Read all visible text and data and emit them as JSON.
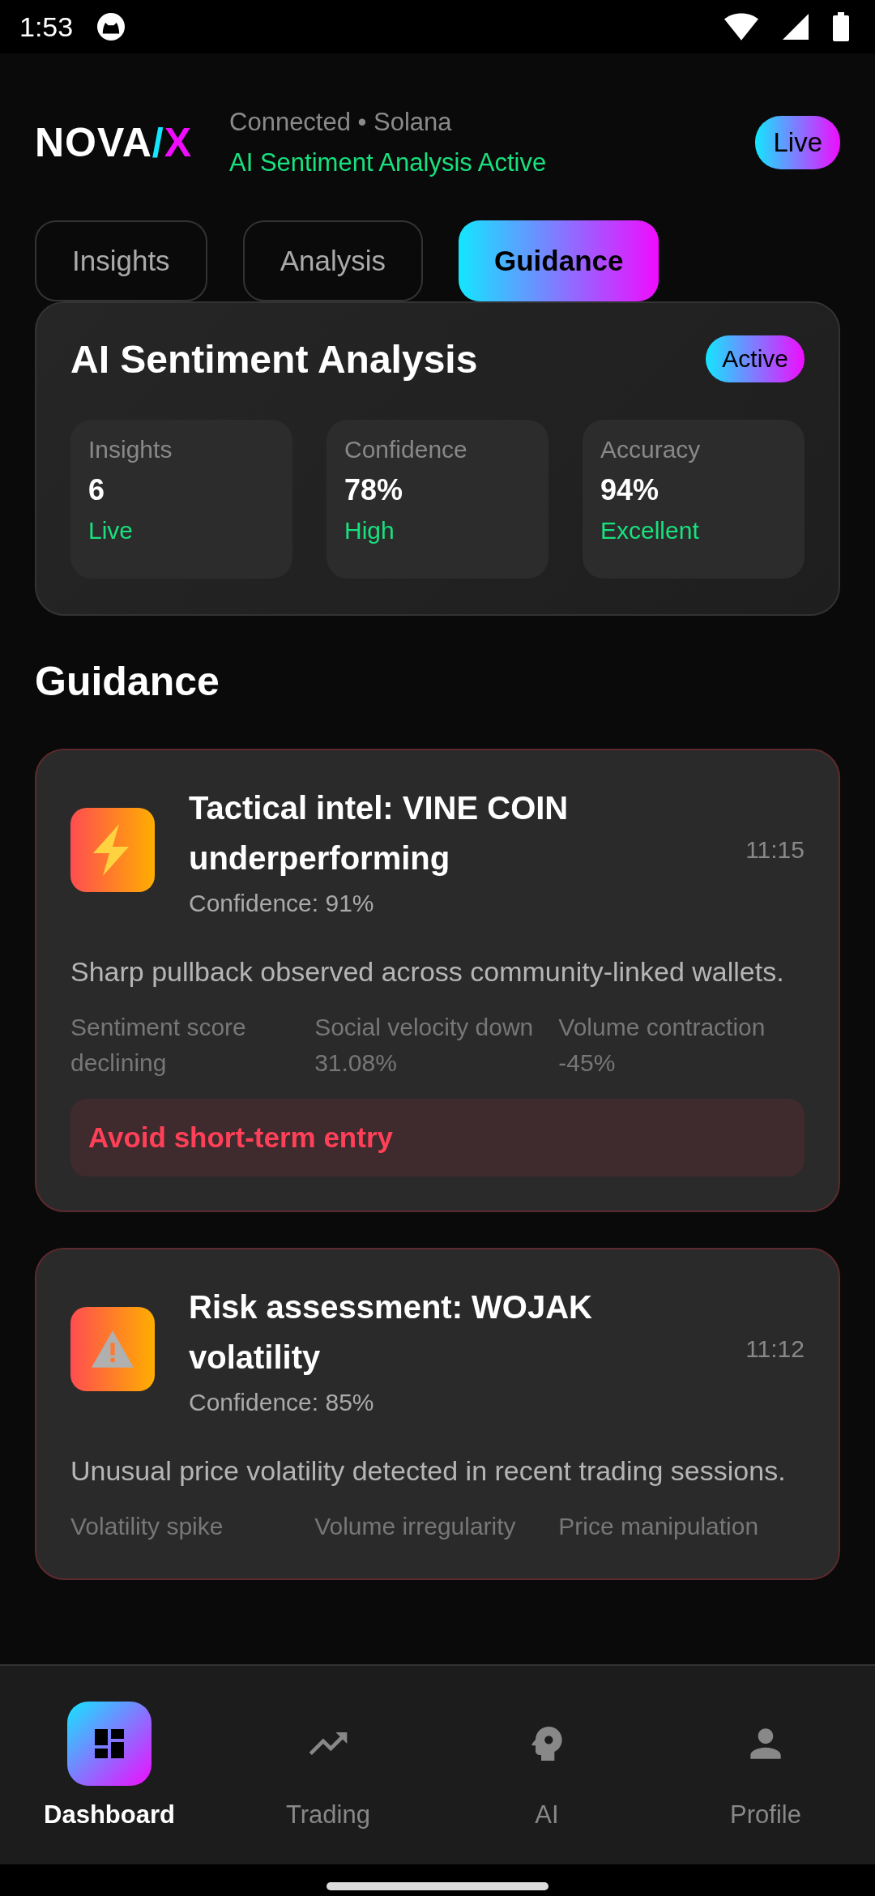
{
  "status_bar": {
    "time": "1:53"
  },
  "header": {
    "logo": {
      "main": "NOVA",
      "slash": "/",
      "accent": "X"
    },
    "connection": "Connected • Solana",
    "status": "AI Sentiment Analysis Active",
    "badge": "Live"
  },
  "tabs": [
    {
      "label": "Insights",
      "selected": false
    },
    {
      "label": "Analysis",
      "selected": false
    },
    {
      "label": "Guidance",
      "selected": true
    }
  ],
  "summary": {
    "title": "AI Sentiment Analysis",
    "badge": "Active",
    "stats": [
      {
        "label": "Insights",
        "value": "6",
        "note": "Live"
      },
      {
        "label": "Confidence",
        "value": "78%",
        "note": "High"
      },
      {
        "label": "Accuracy",
        "value": "94%",
        "note": "Excellent"
      }
    ]
  },
  "section_title": "Guidance",
  "cards": [
    {
      "kind": "bolt",
      "title": "Tactical intel: VINE COIN underperforming",
      "confidence": "Confidence: 91%",
      "time": "11:15",
      "description": "Sharp pullback observed across community-linked wallets.",
      "factors": [
        "Sentiment score declining",
        "Social velocity down 31.08%",
        "Volume contraction -45%"
      ],
      "recommendation": "Avoid short-term entry"
    },
    {
      "kind": "warning",
      "title": "Risk assessment: WOJAK volatility",
      "confidence": "Confidence: 85%",
      "time": "11:12",
      "description": "Unusual price volatility detected in recent trading sessions.",
      "factors": [
        "Volatility spike",
        "Volume irregularity",
        "Price manipulation"
      ]
    }
  ],
  "nav": [
    {
      "label": "Dashboard",
      "selected": true
    },
    {
      "label": "Trading",
      "selected": false
    },
    {
      "label": "AI",
      "selected": false
    },
    {
      "label": "Profile",
      "selected": false
    }
  ]
}
